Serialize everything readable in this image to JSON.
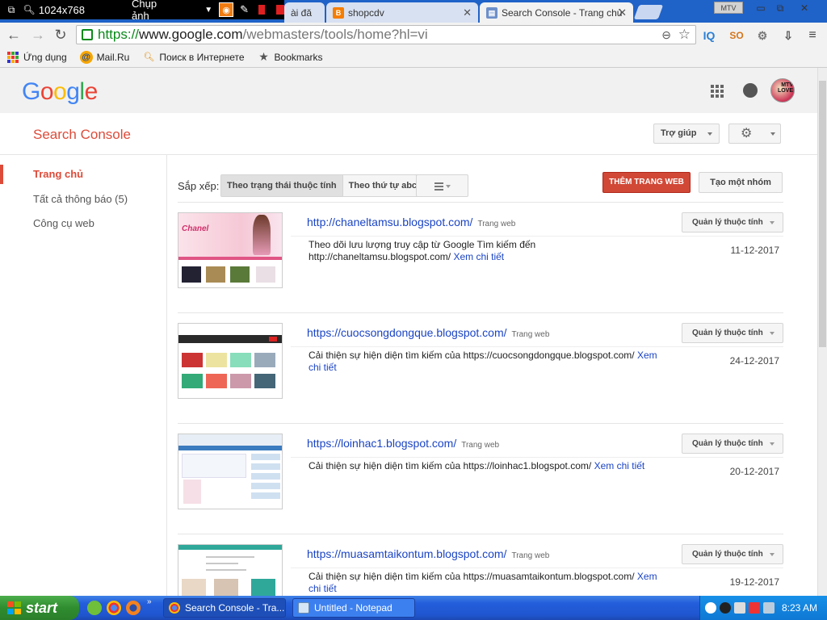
{
  "capture_tool": {
    "size_label": "1024x768",
    "capture_label": "Chụp ảnh"
  },
  "tabs": [
    {
      "label": "ài đă",
      "favicon": "page",
      "active": false
    },
    {
      "label": "shopcdv",
      "favicon": "blogger",
      "active": false
    },
    {
      "label": "Search Console - Trang chủ",
      "favicon": "search-console",
      "active": true
    }
  ],
  "window": {
    "mtv_label": "MTV"
  },
  "address_bar": {
    "scheme": "https://",
    "host": "www.google.com",
    "path": "/webmasters/tools/home?hl=vi"
  },
  "extensions": [
    "IQ",
    "SO"
  ],
  "bookmarks": [
    {
      "label": "Ứng dụng",
      "icon": "apps-icon"
    },
    {
      "label": "Mail.Ru",
      "icon": "mailru-icon"
    },
    {
      "label": "Поиск в Интернете",
      "icon": "search-icon"
    },
    {
      "label": "Bookmarks",
      "icon": "star-icon"
    }
  ],
  "google_header": {
    "logo_text": "Google",
    "avatar_text": "MTV LOVE"
  },
  "search_console": {
    "title": "Search Console",
    "help_label": "Trợ giúp"
  },
  "sidebar": [
    {
      "label": "Trang chủ",
      "active": true
    },
    {
      "label": "Tất cả thông báo (5)",
      "active": false
    },
    {
      "label": "Công cụ web",
      "active": false
    }
  ],
  "toolbar": {
    "sort_label": "Sắp xếp:",
    "sort_by_status": "Theo trạng thái thuộc tính",
    "sort_by_alpha": "Theo thứ tự abc",
    "add_site": "THÊM TRANG WEB",
    "create_group": "Tạo một nhóm"
  },
  "sites": [
    {
      "url": "http://chaneltamsu.blogspot.com/",
      "type": "Trang web",
      "manage_label": "Quản lý thuộc tính",
      "desc_prefix": "Theo dõi lưu lượng truy cập từ Google Tìm kiếm đến http://chaneltamsu.blogspot.com/",
      "more": "Xem chi tiết",
      "date": "11-12-2017",
      "thumb_text": "Chanel"
    },
    {
      "url": "https://cuocsongdongque.blogspot.com/",
      "type": "Trang web",
      "manage_label": "Quản lý thuộc tính",
      "desc_prefix": "Cải thiện sự hiện diện tìm kiếm của https://cuocsongdongque.blogspot.com/",
      "more": "Xem chi tiết",
      "date": "24-12-2017"
    },
    {
      "url": "https://loinhac1.blogspot.com/",
      "type": "Trang web",
      "manage_label": "Quản lý thuộc tính",
      "desc_prefix": "Cải thiện sự hiện diện tìm kiếm của https://loinhac1.blogspot.com/",
      "more": "Xem chi tiết",
      "date": "20-12-2017"
    },
    {
      "url": "https://muasamtaikontum.blogspot.com/",
      "type": "Trang web",
      "manage_label": "Quản lý thuộc tính",
      "desc_prefix": "Cải thiện sự hiện diện tìm kiếm của https://muasamtaikontum.blogspot.com/",
      "more": "Xem chi tiết",
      "date": "19-12-2017"
    }
  ],
  "taskbar": {
    "start_label": "start",
    "items": [
      {
        "label": "Search Console - Tra...",
        "icon": "chrome-icon",
        "active": true
      },
      {
        "label": "Untitled - Notepad",
        "icon": "notepad-icon",
        "active": false
      }
    ],
    "clock": "8:23 AM"
  },
  "colors": {
    "accent_red": "#dd4b39",
    "link_blue": "#1a44c4",
    "secure_green": "#0a8a1a"
  }
}
